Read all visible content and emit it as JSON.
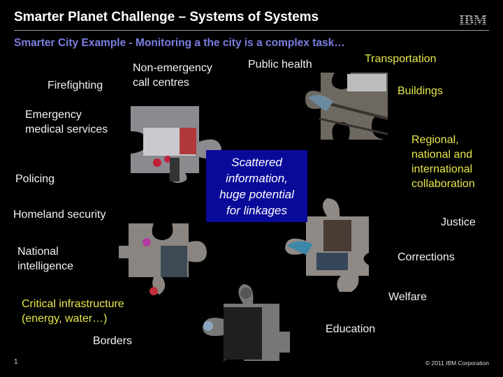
{
  "header": {
    "title": "Smarter Planet Challenge – Systems of Systems",
    "logo_text": "IBM",
    "subtitle": "Smarter City Example - Monitoring a the city is a complex task…"
  },
  "labels": {
    "firefighting": "Firefighting",
    "non_emergency": "Non-emergency\ncall centres",
    "public_health": "Public health",
    "transportation": "Transportation",
    "buildings": "Buildings",
    "ems": "Emergency\nmedical services",
    "regional": "Regional,\nnational and\ninternational\ncollaboration",
    "policing": "Policing",
    "homeland": "Homeland security",
    "justice": "Justice",
    "national_intel": "National\nintelligence",
    "corrections": "Corrections",
    "critical_infra": "Critical infrastructure\n(energy, water…)",
    "welfare": "Welfare",
    "education": "Education",
    "borders": "Borders"
  },
  "center_box": {
    "text": "Scattered\ninformation,\nhuge potential\nfor linkages"
  },
  "colors": {
    "subtitle": "#7b7fe0",
    "highlight": "#e6e84a",
    "box": "#0a0a9a"
  },
  "footer": {
    "page": "1",
    "copyright": "© 2011 IBM Corporation"
  }
}
